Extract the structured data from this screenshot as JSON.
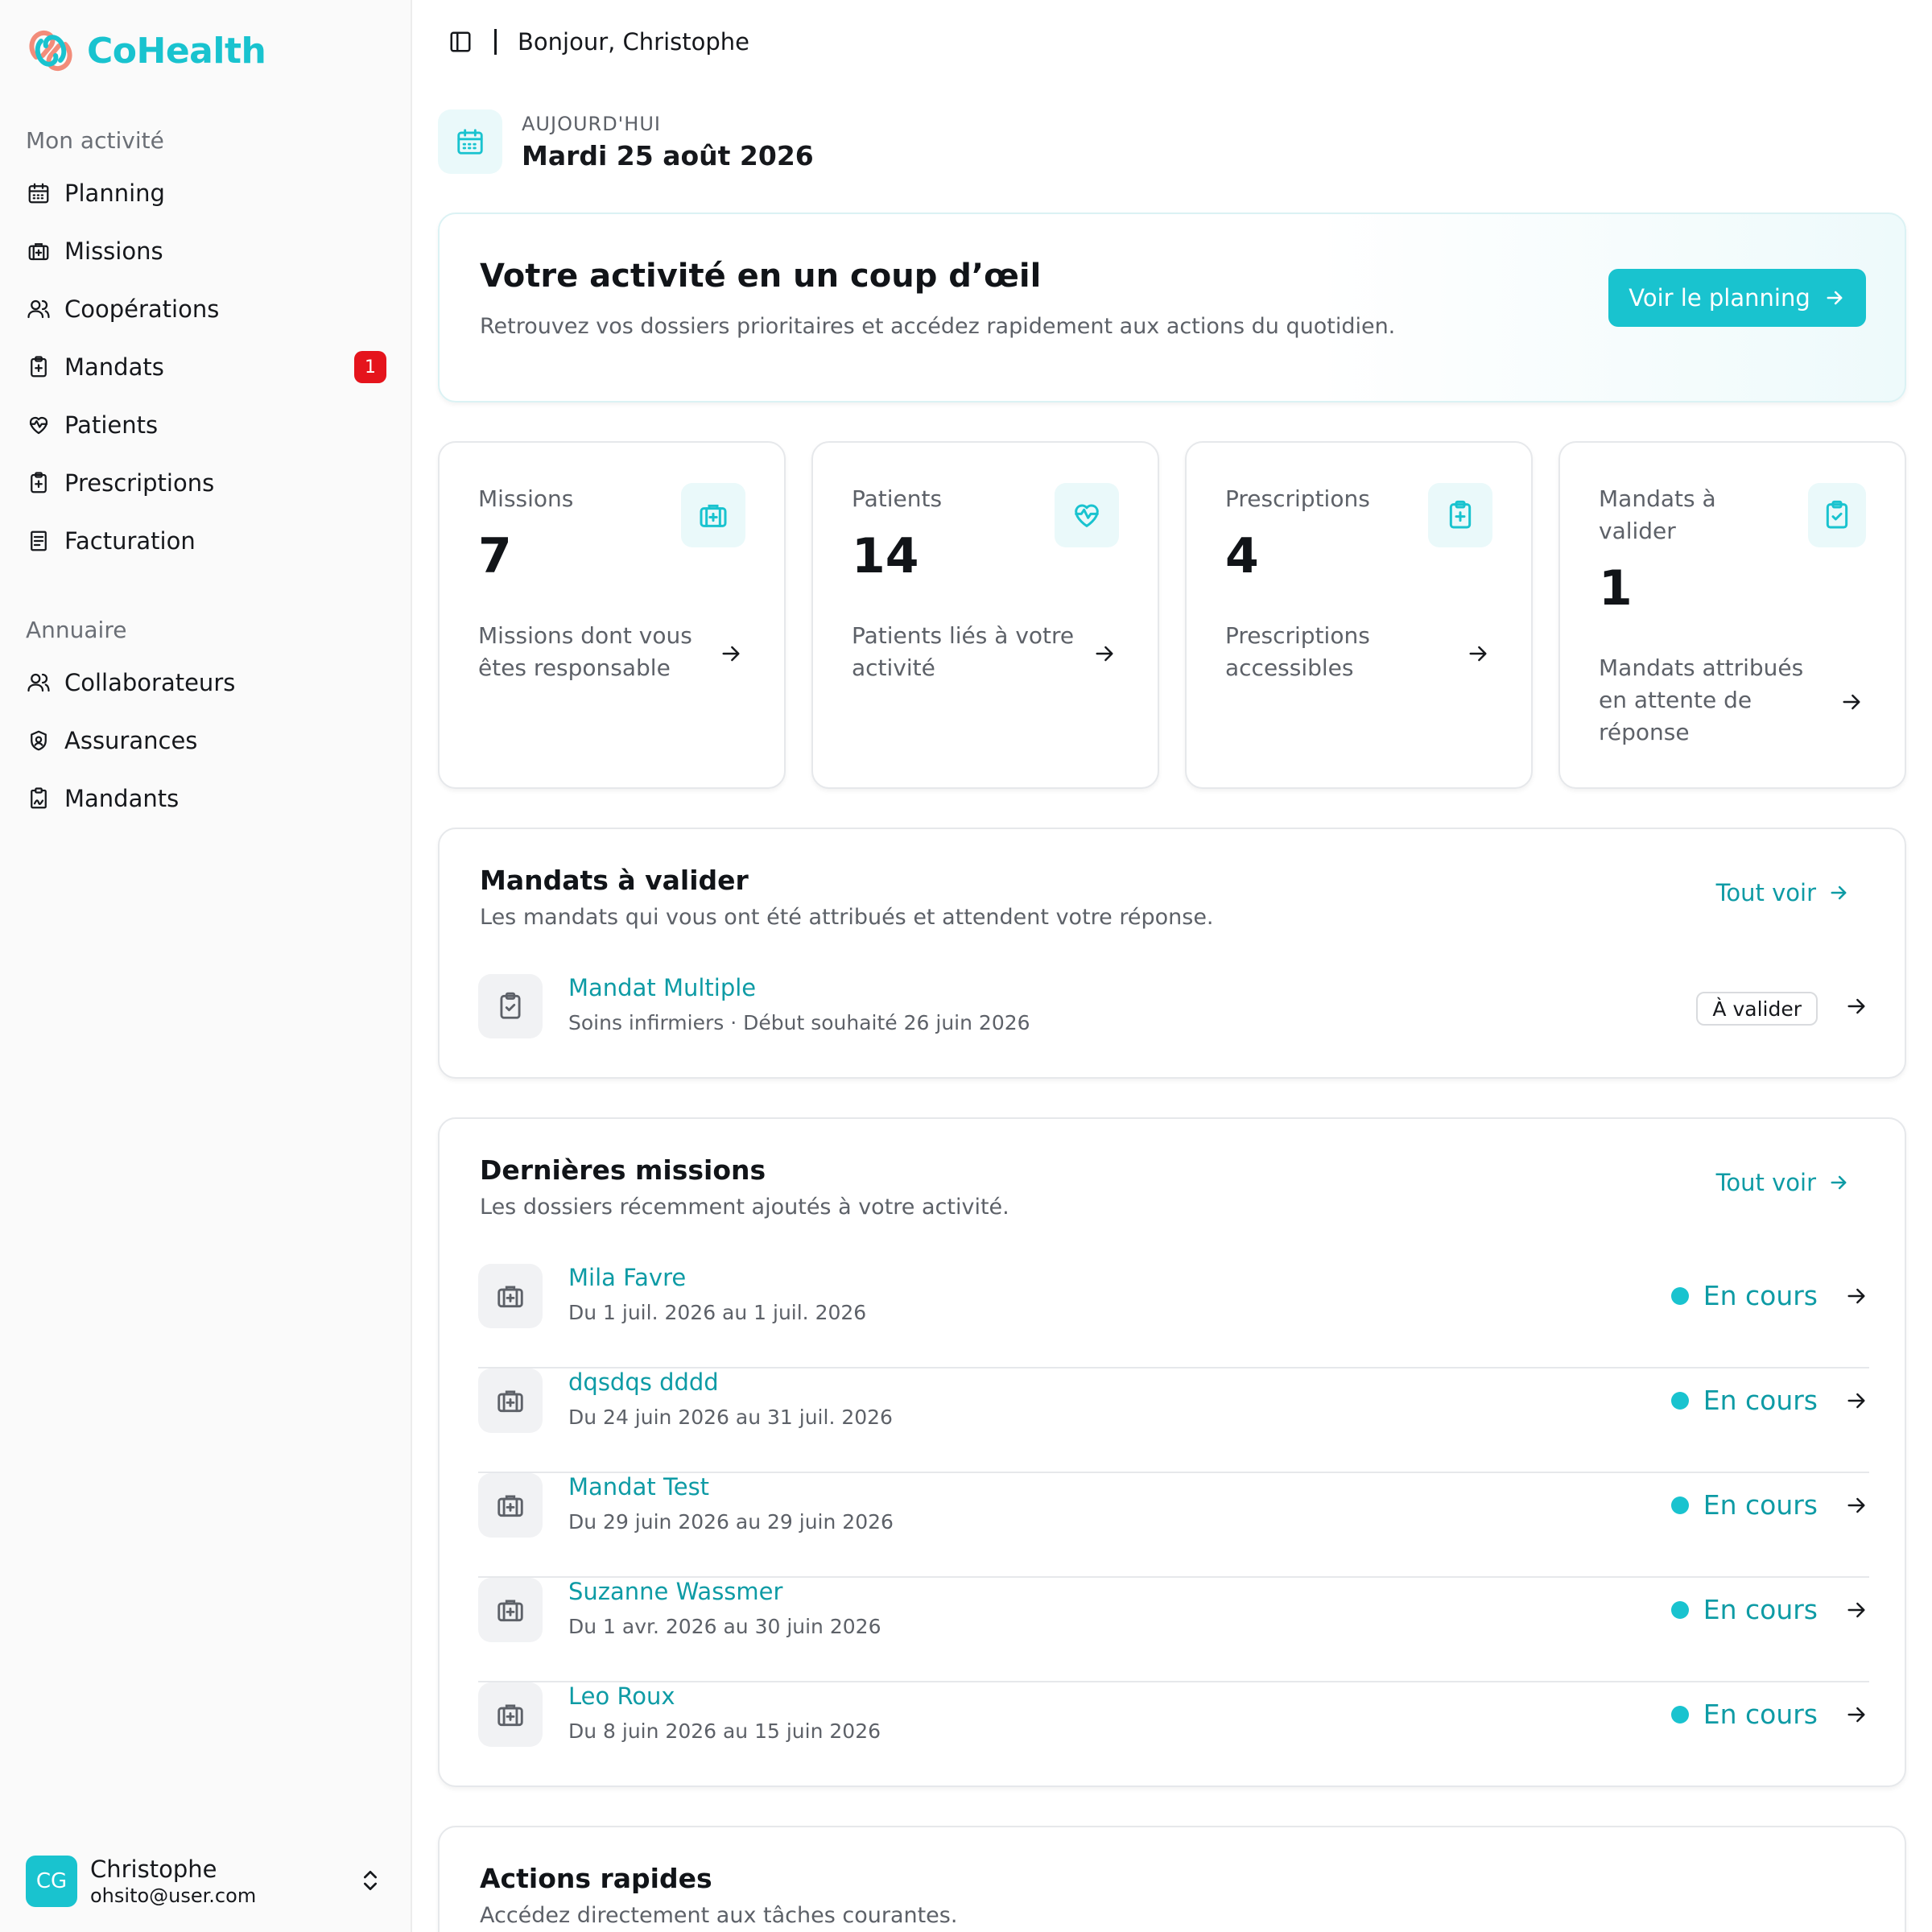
{
  "app": {
    "name": "CoHealth"
  },
  "sidebar": {
    "section_activity": "Mon activité",
    "activity_items": [
      {
        "label": "Planning",
        "icon": "calendar-icon"
      },
      {
        "label": "Missions",
        "icon": "briefcase-medical-icon"
      },
      {
        "label": "Coopérations",
        "icon": "users-icon"
      },
      {
        "label": "Mandats",
        "icon": "clipboard-plus-icon",
        "badge": "1"
      },
      {
        "label": "Patients",
        "icon": "heart-pulse-icon"
      },
      {
        "label": "Prescriptions",
        "icon": "clipboard-plus-icon"
      },
      {
        "label": "Facturation",
        "icon": "receipt-icon"
      }
    ],
    "section_directory": "Annuaire",
    "directory_items": [
      {
        "label": "Collaborateurs",
        "icon": "users-icon"
      },
      {
        "label": "Assurances",
        "icon": "shield-icon"
      },
      {
        "label": "Mandants",
        "icon": "clipboard-signature-icon"
      }
    ],
    "user": {
      "initials": "CG",
      "name": "Christophe",
      "email": "ohsito@user.com"
    }
  },
  "topbar": {
    "greeting": "Bonjour, Christophe"
  },
  "today": {
    "label": "AUJOURD'HUI",
    "date": "Mardi 25 août 2026"
  },
  "hero": {
    "title": "Votre activité en un coup d’œil",
    "subtitle": "Retrouvez vos dossiers prioritaires et accédez rapidement aux actions du quotidien.",
    "button": "Voir le planning"
  },
  "stats": [
    {
      "label": "Missions",
      "value": "7",
      "description": "Missions dont vous êtes responsable",
      "icon": "briefcase-medical-icon"
    },
    {
      "label": "Patients",
      "value": "14",
      "description": "Patients liés à votre activité",
      "icon": "heart-pulse-icon"
    },
    {
      "label": "Prescriptions",
      "value": "4",
      "description": "Prescriptions accessibles",
      "icon": "clipboard-plus-icon"
    },
    {
      "label": "Mandats à valider",
      "value": "1",
      "description": "Mandats attribués en attente de réponse",
      "icon": "clipboard-check-icon"
    }
  ],
  "mandates": {
    "title": "Mandats à valider",
    "subtitle": "Les mandats qui vous ont été attribués et attendent votre réponse.",
    "link": "Tout voir",
    "items": [
      {
        "title": "Mandat Multiple",
        "subtitle": "Soins infirmiers · Début souhaité 26 juin 2026",
        "status": "À valider"
      }
    ]
  },
  "missions": {
    "title": "Dernières missions",
    "subtitle": "Les dossiers récemment ajoutés à votre activité.",
    "link": "Tout voir",
    "items": [
      {
        "title": "Mila Favre",
        "subtitle": "Du 1 juil. 2026 au 1 juil. 2026",
        "status": "En cours"
      },
      {
        "title": "dqsdqs dddd",
        "subtitle": "Du 24 juin 2026 au 31 juil. 2026",
        "status": "En cours"
      },
      {
        "title": "Mandat Test",
        "subtitle": "Du 29 juin 2026 au 29 juin 2026",
        "status": "En cours"
      },
      {
        "title": "Suzanne Wassmer",
        "subtitle": "Du 1 avr. 2026 au 30 juin 2026",
        "status": "En cours"
      },
      {
        "title": "Leo Roux",
        "subtitle": "Du 8 juin 2026 au 15 juin 2026",
        "status": "En cours"
      }
    ]
  },
  "quick_actions": {
    "title": "Actions rapides",
    "subtitle": "Accédez directement aux tâches courantes."
  },
  "colors": {
    "accent": "#19c3cf",
    "accent_text": "#0e9ba5",
    "badge": "#e5141c",
    "logo_secondary": "#f28c7a"
  }
}
